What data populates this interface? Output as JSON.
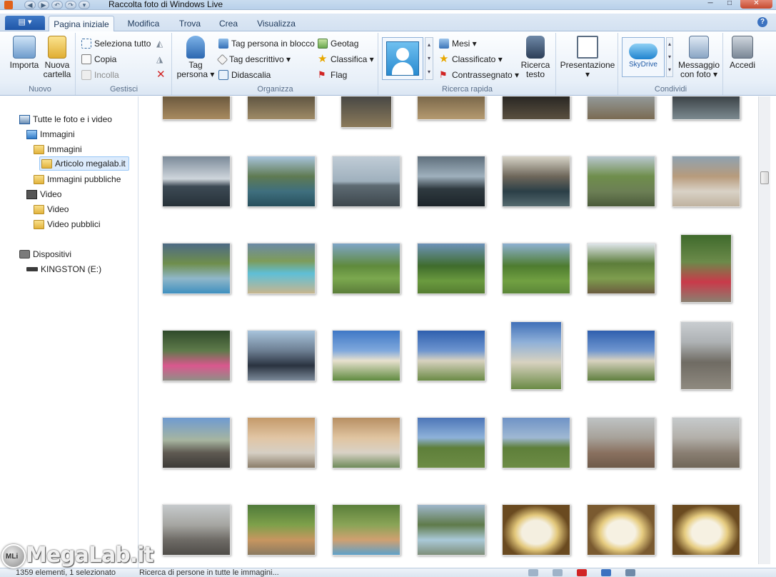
{
  "window": {
    "title": "Raccolta foto di Windows Live",
    "minimize": "─",
    "maximize": "□",
    "close": "✕"
  },
  "ribbon_tabs": {
    "file_menu": "▤ ▾",
    "tabs": [
      {
        "label": "Pagina iniziale",
        "active": true
      },
      {
        "label": "Modifica"
      },
      {
        "label": "Trova"
      },
      {
        "label": "Crea"
      },
      {
        "label": "Visualizza"
      }
    ],
    "help": "?"
  },
  "ribbon": {
    "groups": {
      "nuovo": "Nuovo",
      "gestisci": "Gestisci",
      "organizza": "Organizza",
      "ricerca_rapida": "Ricerca rapida",
      "condividi": "Condividi"
    },
    "importa": "Importa",
    "nuova_cartella": [
      "Nuova",
      "cartella"
    ],
    "seleziona_tutto": "Seleziona tutto",
    "copia": "Copia",
    "incolla": "Incolla",
    "tag_persona": [
      "Tag",
      "persona ▾"
    ],
    "tag_persona_blocco": "Tag persona in blocco",
    "tag_descrittivo": "Tag descrittivo ▾",
    "didascalia": "Didascalia",
    "geotag": "Geotag",
    "classifica": "Classifica ▾",
    "flag": "Flag",
    "mesi": "Mesi ▾",
    "classificato": "Classificato ▾",
    "contrassegnato": "Contrassegnato ▾",
    "ricerca_testo": [
      "Ricerca",
      "testo"
    ],
    "presentazione": [
      "Presentazione",
      "▾"
    ],
    "skydrive": "SkyDrive",
    "messaggio_foto": [
      "Messaggio",
      "con foto ▾"
    ],
    "accedi": "Accedi"
  },
  "nav": {
    "items": [
      {
        "label": "Tutte le foto e i video",
        "icon": "library-icon"
      },
      {
        "label": "Immagini",
        "icon": "pictures-icon"
      },
      {
        "label": "Immagini",
        "icon": "folder-icon"
      },
      {
        "label": "Articolo megalab.it",
        "icon": "folder-icon",
        "selected": true
      },
      {
        "label": "Immagini pubbliche",
        "icon": "folder-icon"
      },
      {
        "label": "Video",
        "icon": "video-icon"
      },
      {
        "label": "Video",
        "icon": "folder-icon"
      },
      {
        "label": "Video pubblici",
        "icon": "folder-icon"
      },
      {
        "label": "Dispositivi",
        "icon": "camera-icon"
      },
      {
        "label": "KINGSTON (E:)",
        "icon": "usb-drive-icon"
      }
    ]
  },
  "status": {
    "count": "1359 elementi, 1 selezionato",
    "hint": "Ricerca di persone in tutte le immagini..."
  },
  "watermark": {
    "logo": "MLi",
    "text": "MegaLab.it"
  },
  "colors": {
    "accent": "#1f56a8",
    "selection": "#dcebfc",
    "ribbon_border": "#a5bcd8"
  }
}
